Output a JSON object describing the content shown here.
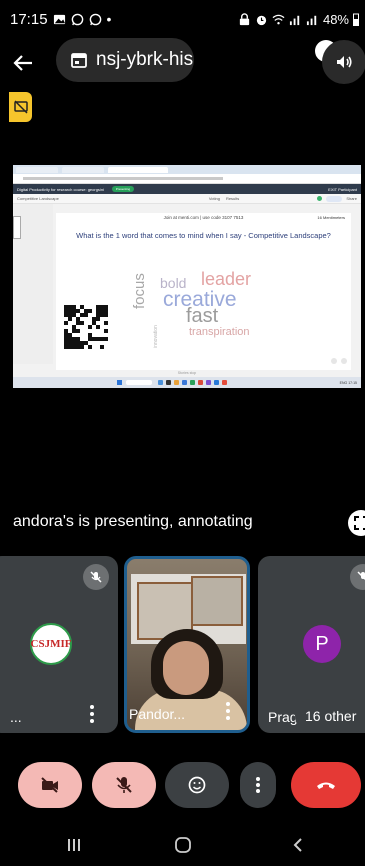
{
  "status_bar": {
    "time": "17:15",
    "battery": "48%"
  },
  "header": {
    "meeting_code": "nsj-ybrk-his"
  },
  "shared_screen": {
    "join_text": "Join at menti.com | use code 3107 7513",
    "responses": "16 Mentimeters",
    "question": "What is the 1 word that comes to mind when I say - Competitive Landscape?",
    "tabs": [
      "Presentations",
      "Mentimeter",
      "Competitive Landsc..."
    ],
    "toolbar_left": "Competitive Landscape",
    "toolbar_right": "Share",
    "menu_mid": [
      "Voting",
      "Results"
    ],
    "app_title": "Digital Productivity for research course: georgsini",
    "app_pill": "Presenting",
    "app_right": "EXIT Participant",
    "status_strip": "Stories stop",
    "taskbar_right": "ENG 17:15",
    "word_cloud": [
      {
        "text": "bold",
        "color": "#b9b3c9"
      },
      {
        "text": "leader",
        "color": "#e3a3a3"
      },
      {
        "text": "creative",
        "color": "#9aa9da"
      },
      {
        "text": "focus",
        "color": "#a7a7a7"
      },
      {
        "text": "fast",
        "color": "#9c9c9c"
      },
      {
        "text": "transpiration",
        "color": "#d8a6a6"
      },
      {
        "text": "innovation",
        "color": "#b7b7b7"
      }
    ]
  },
  "presenting": {
    "label": "andora's is presenting, annotating"
  },
  "participants": [
    {
      "name": "..."
    },
    {
      "name": "Pandor..."
    },
    {
      "name": "Prag",
      "avatar_letter": "P"
    }
  ],
  "others_badge": "16 other",
  "logo_text": "CSJMIF",
  "colors": {
    "end_call": "#e53935",
    "muted_bg": "#f4b9b5",
    "tile_bg": "#3c4043",
    "active_border": "#1f5e8e"
  }
}
